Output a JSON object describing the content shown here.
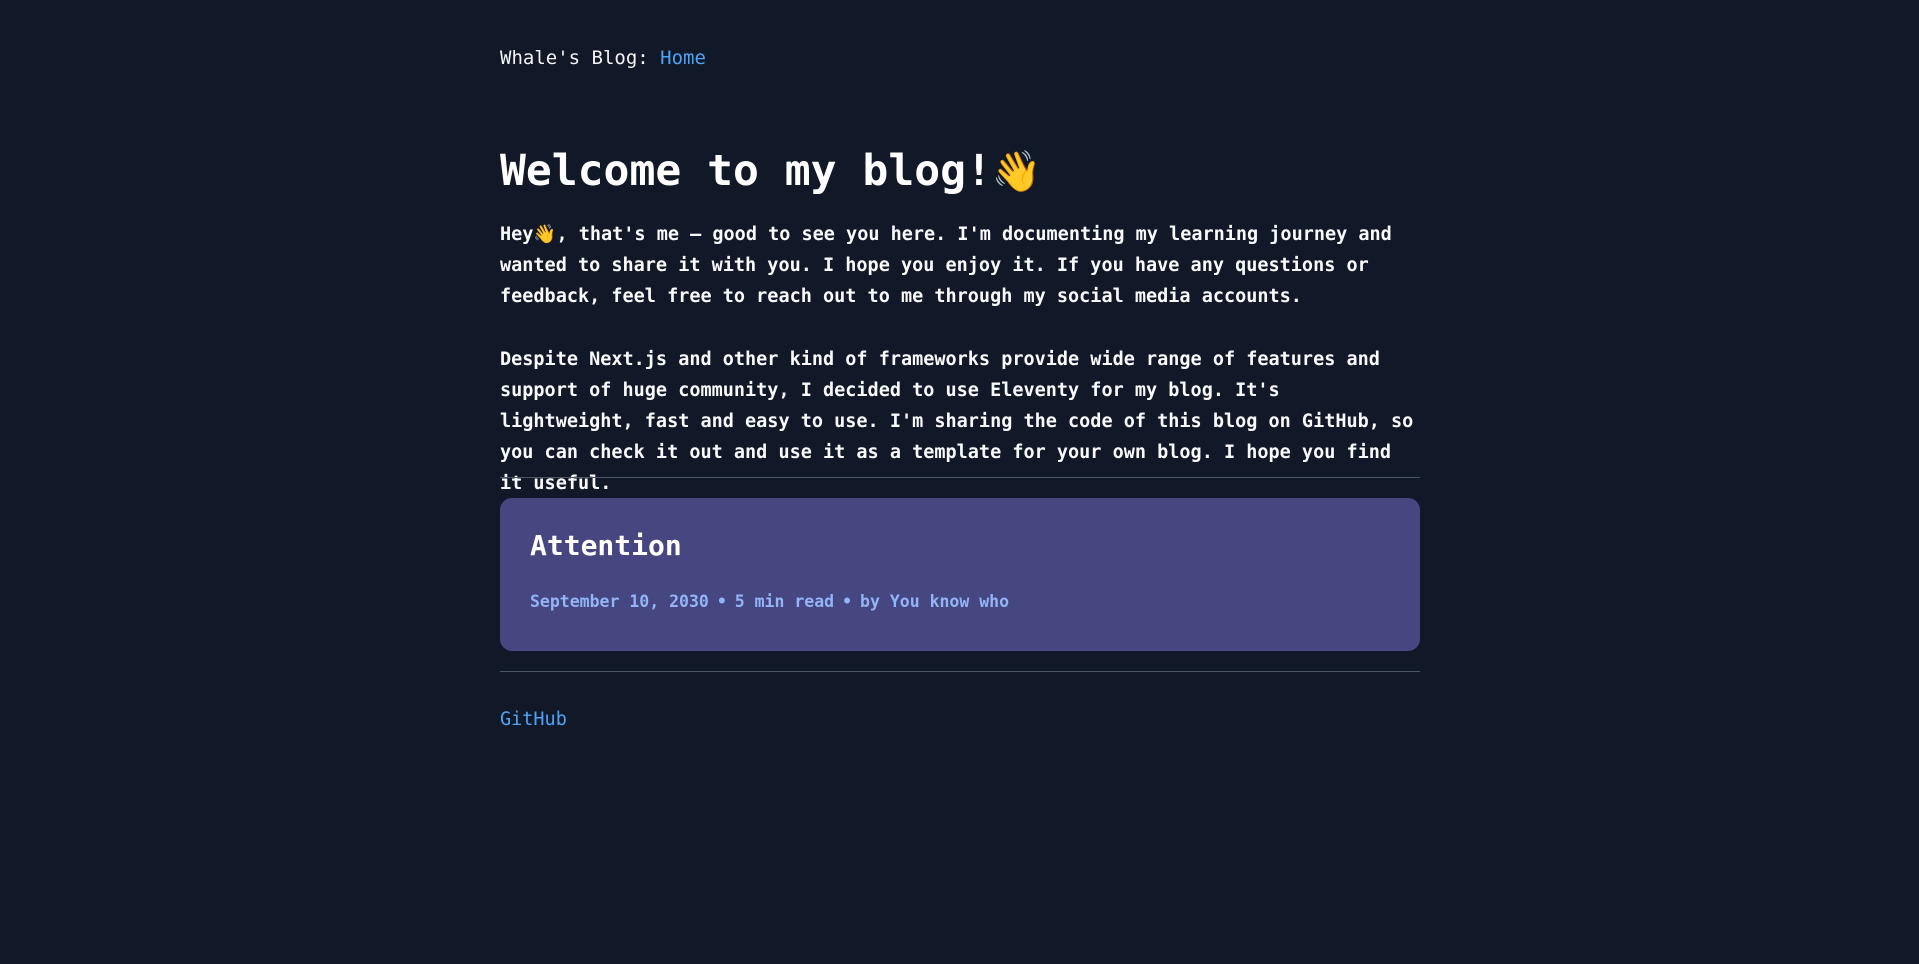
{
  "header": {
    "brand": "Whale's Blog:",
    "home_link": "Home"
  },
  "main": {
    "title": "Welcome to my blog!",
    "title_emoji": "👋",
    "intro_paragraph_1_prefix": "Hey",
    "intro_paragraph_1_emoji": "👋",
    "intro_paragraph_1_rest": ", that's me — good to see you here. I'm documenting my learning journey and wanted to share it with you. I hope you enjoy it. If you have any questions or feedback, feel free to reach out to me through my social media accounts.",
    "intro_paragraph_2": "Despite Next.js and other kind of frameworks provide wide range of features and support of huge community, I decided to use Eleventy for my blog. It's lightweight, fast and easy to use. I'm sharing the code of this blog on GitHub, so you can check it out and use it as a template for your own blog. I hope you find it useful."
  },
  "posts": [
    {
      "title": "Attention",
      "date": "September 10, 2030",
      "separator": "•",
      "read_time": "5 min read",
      "author": "by You know who"
    }
  ],
  "footer": {
    "github_link": "GitHub"
  },
  "colors": {
    "background": "#111827",
    "link": "#4fa3f7",
    "card_background": "#464681",
    "meta_text": "#93b4f5",
    "divider": "#4b5563"
  }
}
